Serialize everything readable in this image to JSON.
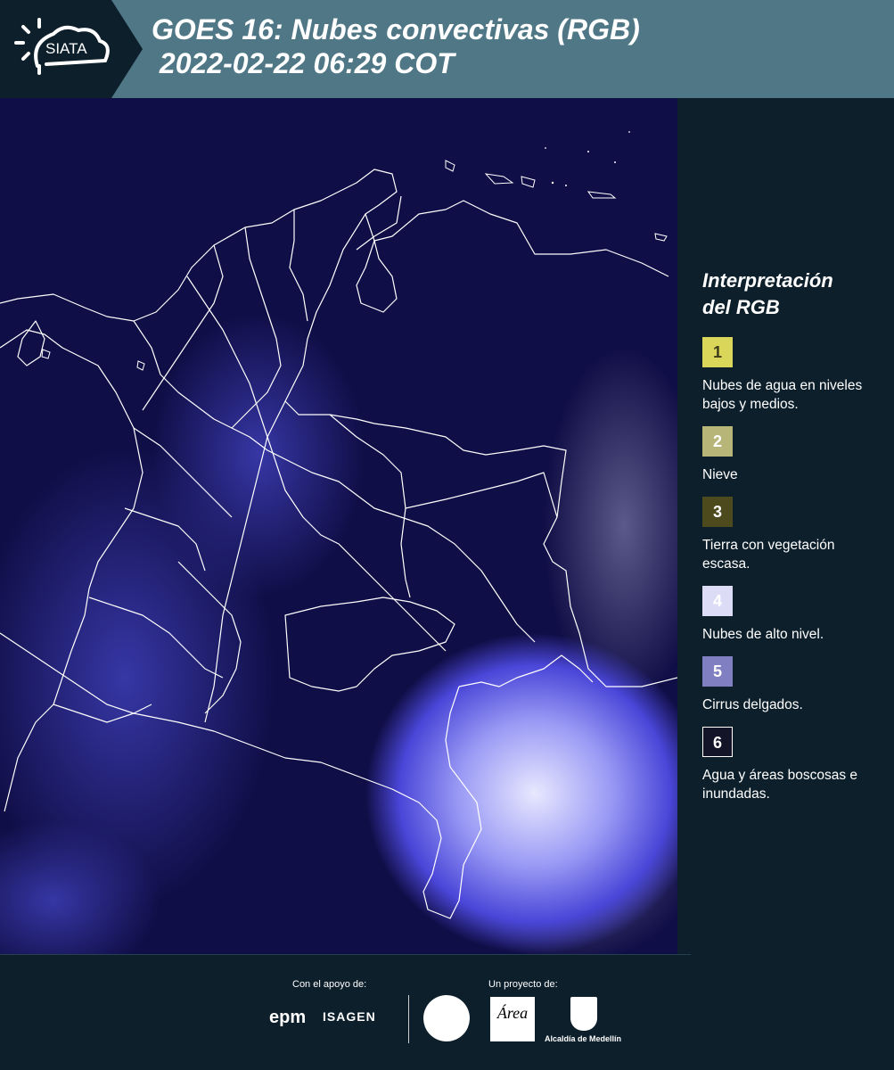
{
  "header": {
    "logo_text": "SIATA",
    "title_line1": "GOES 16: Nubes convectivas (RGB)",
    "title_line2": " 2022-02-22 06:29 COT"
  },
  "legend": {
    "title_line1": "Interpretación",
    "title_line2": "del RGB",
    "items": [
      {
        "number": "1",
        "text": "Nubes de agua en niveles bajos y medios.",
        "color": "#d9d65a",
        "text_color": "#3c3c1a"
      },
      {
        "number": "2",
        "text": "Nieve",
        "color": "#b8b578",
        "text_color": "#ffffff"
      },
      {
        "number": "3",
        "text": "Tierra con vegetación escasa.",
        "color": "#4d4a1d",
        "text_color": "#ffffff"
      },
      {
        "number": "4",
        "text": "Nubes de alto nivel.",
        "color": "#dcdcf7",
        "text_color": "#ffffff"
      },
      {
        "number": "5",
        "text": "Cirrus delgados.",
        "color": "#7f7fc2",
        "text_color": "#ffffff"
      },
      {
        "number": "6",
        "text": "Agua y áreas boscosas e inundadas.",
        "color": "#141428",
        "text_color": "#ffffff"
      }
    ]
  },
  "footer": {
    "support_label": "Con el apoyo de:",
    "project_label": "Un proyecto de:",
    "sponsor_1": "epm",
    "sponsor_2": "ISAGEN",
    "partner_area_logo": "Área",
    "partner_alcaldia": "Alcaldía de Medellín"
  },
  "colors": {
    "header_bg": "#4f7786",
    "page_bg": "#0d1f2b",
    "map_bg": "#0f0d44",
    "border_lines": "#ffffff"
  }
}
